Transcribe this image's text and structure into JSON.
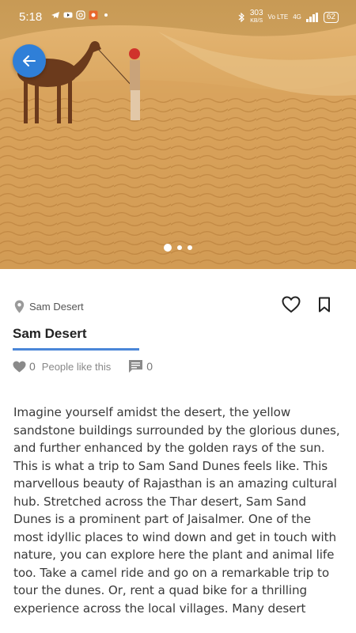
{
  "status_bar": {
    "time": "5:18",
    "network_speed": "303",
    "network_unit": "KB/S",
    "volte": "Vo LTE",
    "signal": "4G",
    "battery": "62"
  },
  "hero": {
    "pager_total": 3,
    "pager_active": 1
  },
  "place": {
    "location": "Sam Desert",
    "title": "Sam Desert",
    "likes_count": "0",
    "likes_label": "People like this",
    "comments_count": "0"
  },
  "description": "Imagine yourself amidst the desert, the yellow sandstone buildings surrounded by the glorious dunes, and further enhanced by the golden rays of the sun. This is what a trip to Sam Sand Dunes feels like. This marvellous beauty of Rajasthan is an amazing cultural hub. Stretched across the Thar desert, Sam Sand Dunes is a prominent part of Jaisalmer.  One of the most idyllic places to wind down and get in touch with nature, you can explore here the plant and animal life too. Take a camel ride and go on a remarkable trip to tour the dunes. Or, rent a quad bike for a thrilling experience across the local villages.  Many desert",
  "colors": {
    "accent": "#2f7fd8",
    "underline": "#4a86d8",
    "sand": "#d9a75f"
  },
  "icons": {
    "back": "arrow-left-icon",
    "location": "map-pin-icon",
    "favorite": "heart-icon",
    "bookmark": "bookmark-icon",
    "likes": "heart-filled-icon",
    "comments": "comment-icon"
  }
}
